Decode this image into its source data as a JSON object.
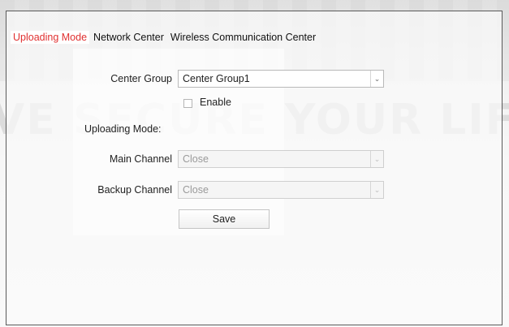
{
  "background": {
    "watermark_text": "VE SECURE YOUR LIFE"
  },
  "tabs": [
    {
      "label": "Uploading Mode",
      "active": true
    },
    {
      "label": "Network Center",
      "active": false
    },
    {
      "label": "Wireless Communication Center",
      "active": false
    }
  ],
  "form": {
    "center_group_label": "Center Group",
    "center_group_value": "Center Group1",
    "enable_label": "Enable",
    "enable_checked": false,
    "uploading_mode_label": "Uploading Mode:",
    "main_channel_label": "Main Channel",
    "main_channel_value": "Close",
    "backup_channel_label": "Backup Channel",
    "backup_channel_value": "Close",
    "save_label": "Save"
  },
  "icons": {
    "dropdown_arrow": "chevron-down-icon"
  },
  "colors": {
    "active_tab": "#e03030",
    "border": "#5a5a5a"
  }
}
